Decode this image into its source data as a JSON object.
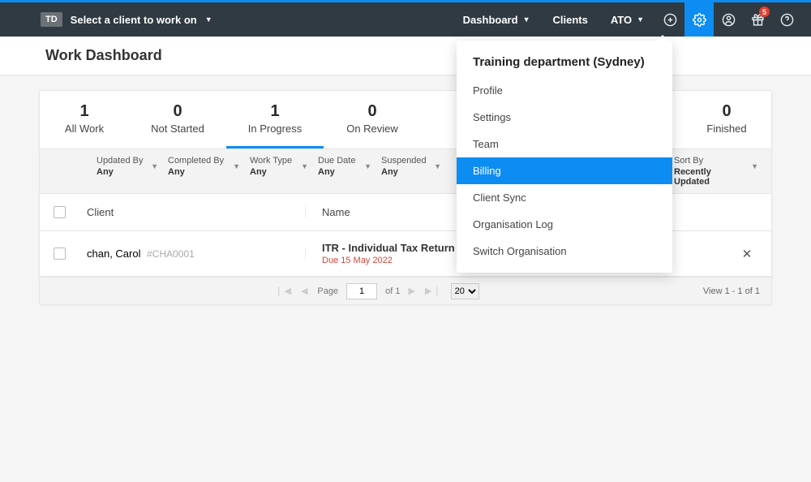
{
  "navbar": {
    "td_badge": "TD",
    "client_selector": "Select a client to work on",
    "links": {
      "dashboard": "Dashboard",
      "clients": "Clients",
      "ato": "ATO"
    },
    "gift_badge": "5"
  },
  "page": {
    "title": "Work Dashboard"
  },
  "tabs": [
    {
      "count": "1",
      "label": "All Work"
    },
    {
      "count": "0",
      "label": "Not Started"
    },
    {
      "count": "1",
      "label": "In Progress"
    },
    {
      "count": "0",
      "label": "On Review"
    },
    {
      "count": "0",
      "label": "Finished"
    }
  ],
  "filters": [
    {
      "label": "Updated By",
      "value": "Any"
    },
    {
      "label": "Completed By",
      "value": "Any"
    },
    {
      "label": "Work Type",
      "value": "Any"
    },
    {
      "label": "Due Date",
      "value": "Any"
    },
    {
      "label": "Suspended",
      "value": "Any"
    },
    {
      "label": "Sort By",
      "value": "Recently Updated"
    }
  ],
  "columns": {
    "client": "Client",
    "name": "Name"
  },
  "rows": [
    {
      "client_name": "chan, Carol",
      "client_id": "#CHA0001",
      "name": "ITR - Individual Tax Return 2022",
      "due": "Due 15 May 2022"
    }
  ],
  "pager": {
    "page_label": "Page",
    "page": "1",
    "of": "of 1",
    "per_page": "20",
    "view_text": "View 1 - 1 of 1"
  },
  "popover": {
    "title": "Training department (Sydney)",
    "items": [
      {
        "label": "Profile"
      },
      {
        "label": "Settings"
      },
      {
        "label": "Team"
      },
      {
        "label": "Billing",
        "active": true
      },
      {
        "label": "Client Sync"
      },
      {
        "label": "Organisation Log"
      },
      {
        "label": "Switch Organisation"
      }
    ]
  }
}
